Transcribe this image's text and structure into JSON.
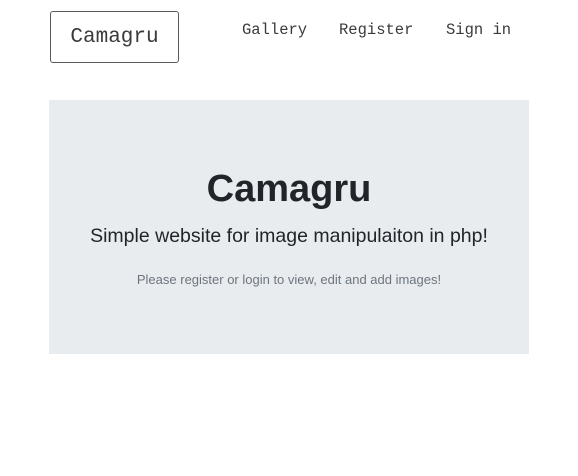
{
  "header": {
    "brand": "Camagru",
    "nav": [
      {
        "label": "Gallery"
      },
      {
        "label": "Register"
      },
      {
        "label": "Sign in"
      }
    ]
  },
  "hero": {
    "title": "Camagru",
    "lead": "Simple website for image manipulaiton in php!",
    "note": "Please register or login to view, edit and add images!"
  },
  "colors": {
    "hero_background": "#e9ecef",
    "text": "#212529",
    "muted_text": "#6c757d",
    "brand_border": "#5a5a5a"
  }
}
